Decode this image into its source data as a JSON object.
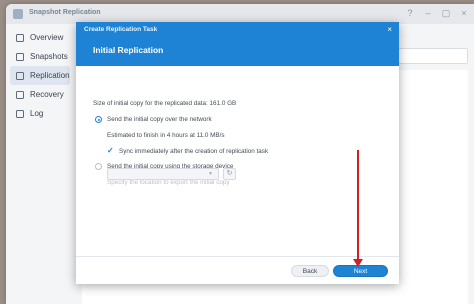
{
  "app": {
    "title": "Snapshot Replication",
    "window_controls": [
      "help-icon",
      "minimize-icon",
      "maximize-icon",
      "close-icon"
    ]
  },
  "sidebar": {
    "items": [
      {
        "label": "Overview",
        "icon": "overview-icon",
        "active": false
      },
      {
        "label": "Snapshots",
        "icon": "snapshots-icon",
        "active": false
      },
      {
        "label": "Replication",
        "icon": "replication-icon",
        "active": true
      },
      {
        "label": "Recovery",
        "icon": "recovery-icon",
        "active": false
      },
      {
        "label": "Log",
        "icon": "log-icon",
        "active": false
      }
    ]
  },
  "dialog": {
    "title": "Create Replication Task",
    "close_glyph": "×",
    "step_title": "Initial Replication",
    "size_text": "Size of initial copy for the replicated data: 161.0 GB",
    "option_network": {
      "label": "Send the initial copy over the network",
      "selected": true,
      "estimate": "Estimated to finish in 4 hours at 11.0 MB/s",
      "sync_label": "Sync immediately after the creation of replication task",
      "sync_checked": true
    },
    "option_storage": {
      "label": "Send the initial copy using the storage device",
      "selected": false,
      "location_label": "Specify the location to export the initial copy",
      "dropdown_value": ""
    },
    "buttons": {
      "back": "Back",
      "next": "Next"
    }
  },
  "colors": {
    "accent": "#1e83d4",
    "annotation_arrow": "#d11f23"
  }
}
